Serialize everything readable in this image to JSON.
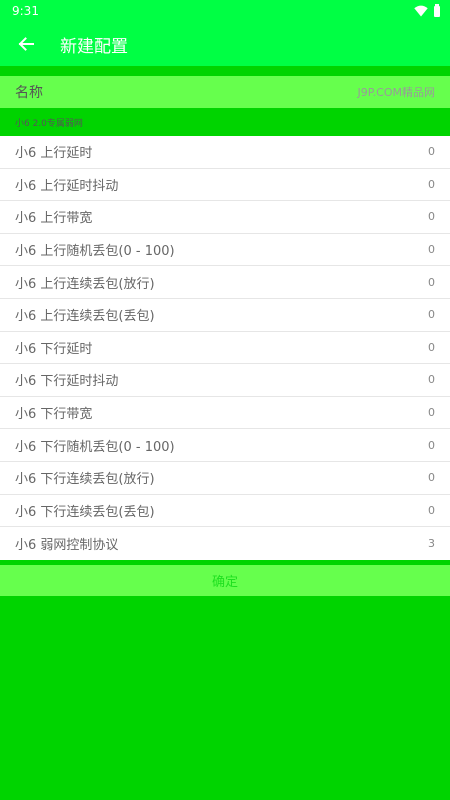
{
  "status_bar": {
    "time": "9:31",
    "icons": [
      "wifi-icon",
      "battery-icon"
    ]
  },
  "app_bar": {
    "title": "新建配置",
    "back_icon": "arrow-left-icon"
  },
  "name_field": {
    "label": "名称",
    "value": "J9P.COM精品网"
  },
  "section": {
    "header": "小6 2.0专属弱网"
  },
  "settings": [
    {
      "label": "小6  上行延时",
      "value": "0"
    },
    {
      "label": "小6  上行延时抖动",
      "value": "0"
    },
    {
      "label": "小6  上行带宽",
      "value": "0"
    },
    {
      "label": "小6  上行随机丢包(0 - 100)",
      "value": "0"
    },
    {
      "label": "小6  上行连续丢包(放行)",
      "value": "0"
    },
    {
      "label": "小6  上行连续丢包(丢包)",
      "value": "0"
    },
    {
      "label": "小6  下行延时",
      "value": "0"
    },
    {
      "label": "小6  下行延时抖动",
      "value": "0"
    },
    {
      "label": "小6  下行带宽",
      "value": "0"
    },
    {
      "label": "小6  下行随机丢包(0 - 100)",
      "value": "0"
    },
    {
      "label": "小6  下行连续丢包(放行)",
      "value": "0"
    },
    {
      "label": "小6  下行连续丢包(丢包)",
      "value": "0"
    },
    {
      "label": "小6  弱网控制协议",
      "value": "3"
    }
  ],
  "confirm": {
    "label": "确定"
  },
  "colors": {
    "app_bar": "#00ff44",
    "background": "#00d400",
    "name_row": "#66ff4d",
    "list_background": "#ffffff"
  }
}
